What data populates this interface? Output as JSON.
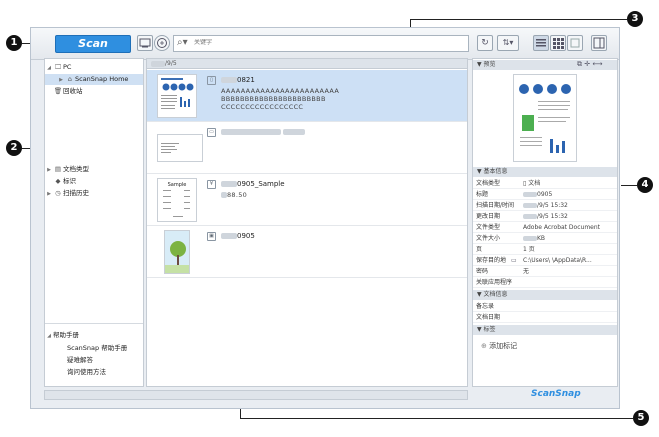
{
  "callouts": [
    "1",
    "2",
    "3",
    "4",
    "5"
  ],
  "toolbar": {
    "scan_label": "Scan",
    "search_placeholder": "关键字",
    "search_icon_glyph": "🔍"
  },
  "tree": {
    "pc": "PC",
    "scansnap_home": "ScanSnap Home",
    "recycle_bin": "回收站",
    "doc_type": "文档类型",
    "tags": "标识",
    "scan_history": "扫描历史"
  },
  "help": {
    "header": "帮助手册",
    "items": [
      "ScanSnap 帮助手册",
      "疑难解答",
      "询问使用方法"
    ]
  },
  "list": {
    "date_header": "/9/5",
    "items": [
      {
        "name": "0821",
        "lines": [
          "AAAAAAAAAAAAAAAAAAAAAAAA",
          "BBBBBBBBBBBBBBBBBBBBBB",
          "CCCCCCCCCCCCCCCCC"
        ]
      },
      {
        "name": ""
      },
      {
        "name": "0905_Sample",
        "sub": "88.50",
        "thumb_title": "Sample"
      },
      {
        "name": "0905"
      }
    ]
  },
  "preview": {
    "header": "预览"
  },
  "basic_info": {
    "header": "基本信息",
    "rows": [
      {
        "k": "文档类型",
        "v": "文档"
      },
      {
        "k": "标题",
        "v": "0905"
      },
      {
        "k": "扫描日期/时间",
        "v": "/9/5 15:32"
      },
      {
        "k": "更改日期",
        "v": "/9/5 15:32"
      },
      {
        "k": "文件类型",
        "v": "Adobe Acrobat Document"
      },
      {
        "k": "文件大小",
        "v": "KB"
      },
      {
        "k": "页",
        "v": "1 页"
      },
      {
        "k": "保存目的地",
        "v": "C:\\Users\\        \\AppData\\R..."
      },
      {
        "k": "密码",
        "v": "无"
      },
      {
        "k": "关联应用程序",
        "v": ""
      }
    ]
  },
  "doc_info": {
    "header": "文档信息",
    "rows": [
      {
        "k": "备忘录",
        "v": ""
      },
      {
        "k": "文档日期",
        "v": ""
      }
    ]
  },
  "tags_section": {
    "header": "标签",
    "add_label": "添加标记"
  },
  "brand": "ScanSnap",
  "colors": {
    "accent": "#2f8fe0",
    "selection": "#cde0f5"
  }
}
